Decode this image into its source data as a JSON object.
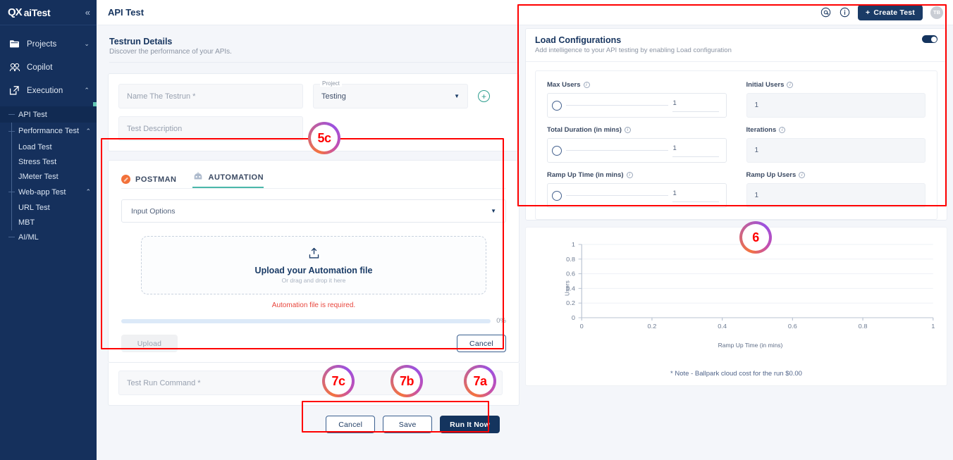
{
  "sidebar": {
    "logo_mark": "QX",
    "logo_text": "aiTest",
    "collapse_icon": "«",
    "items": [
      {
        "label": "Projects",
        "icon": "folder-icon",
        "caret": "⌄"
      },
      {
        "label": "Copilot",
        "icon": "copilot-icon",
        "caret": ""
      },
      {
        "label": "Execution",
        "icon": "execution-icon",
        "caret": "⌃"
      }
    ],
    "sub_items": [
      {
        "label": "API Test",
        "caret": "",
        "active": true,
        "tick": true
      },
      {
        "label": "Performance Test",
        "caret": "⌃",
        "active": false,
        "tick": true
      },
      {
        "label": "Load Test",
        "caret": "",
        "active": false,
        "tick": false
      },
      {
        "label": "Stress Test",
        "caret": "",
        "active": false,
        "tick": false
      },
      {
        "label": "JMeter Test",
        "caret": "",
        "active": false,
        "tick": false
      },
      {
        "label": "Web-app Test",
        "caret": "⌃",
        "active": false,
        "tick": true
      },
      {
        "label": "URL Test",
        "caret": "",
        "active": false,
        "tick": false
      },
      {
        "label": "MBT",
        "caret": "",
        "active": false,
        "tick": false
      },
      {
        "label": "AI/ML",
        "caret": "",
        "active": false,
        "tick": true
      }
    ]
  },
  "topbar": {
    "title": "API Test",
    "at_icon": "@",
    "info_icon": "i",
    "create_label": "Create Test",
    "create_plus": "+",
    "avatar_initials": "TB"
  },
  "testrun": {
    "title": "Testrun Details",
    "subtitle": "Discover the performance of your APIs.",
    "name_placeholder": "Name The Testrun *",
    "project_label": "Project",
    "project_value": "Testing",
    "description_placeholder": "Test Description",
    "add_icon": "+"
  },
  "tabs": {
    "postman": "POSTMAN",
    "automation": "AUTOMATION",
    "active": "AUTOMATION"
  },
  "upload": {
    "input_options_placeholder": "Input Options",
    "dropzone_title": "Upload your Automation file",
    "dropzone_sub": "Or drag and drop it here",
    "error": "Automation file is required.",
    "progress_pct": "0%",
    "progress_value": 0,
    "upload_label": "Upload",
    "cancel_label": "Cancel"
  },
  "command": {
    "placeholder": "Test Run Command *"
  },
  "footer": {
    "cancel_label": "Cancel",
    "save_label": "Save",
    "run_label": "Run It Now"
  },
  "load_config": {
    "title": "Load Configurations",
    "subtitle": "Add intelligence to your API testing by enabling Load configuration",
    "toggle_on": true,
    "fields": [
      {
        "label": "Max Users",
        "value": "1",
        "type": "slider"
      },
      {
        "label": "Initial Users",
        "value": "1",
        "type": "input"
      },
      {
        "label": "Total Duration (in mins)",
        "value": "1",
        "type": "slider"
      },
      {
        "label": "Iterations",
        "value": "1",
        "type": "input"
      },
      {
        "label": "Ramp Up Time (in mins)",
        "value": "1",
        "type": "slider"
      },
      {
        "label": "Ramp Up Users",
        "value": "1",
        "type": "input"
      }
    ]
  },
  "note": "* Note - Ballpark cloud cost for the run $0.00",
  "annotations": [
    {
      "id": "5c",
      "label": "5c"
    },
    {
      "id": "6",
      "label": "6"
    },
    {
      "id": "7a",
      "label": "7a"
    },
    {
      "id": "7b",
      "label": "7b"
    },
    {
      "id": "7c",
      "label": "7c"
    }
  ],
  "colors": {
    "sidebar_bg": "#15305c",
    "primary": "#14345e",
    "accent_teal": "#4bb8a9",
    "error_red": "#e8453c",
    "annotation_red": "#ff0000",
    "postman_orange": "#f2713a"
  },
  "chart_data": {
    "type": "line",
    "title": "",
    "xlabel": "Ramp Up Time (in mins)",
    "ylabel": "Users",
    "x_ticks": [
      "0",
      "0.2",
      "0.4",
      "0.6",
      "0.8",
      "1"
    ],
    "y_ticks": [
      "0",
      "0.2",
      "0.4",
      "0.6",
      "0.8",
      "1"
    ],
    "xlim": [
      0,
      1
    ],
    "ylim": [
      0,
      1
    ],
    "grid": true,
    "legend": "none",
    "series": [
      {
        "name": "Users",
        "x": [],
        "y": []
      }
    ]
  }
}
